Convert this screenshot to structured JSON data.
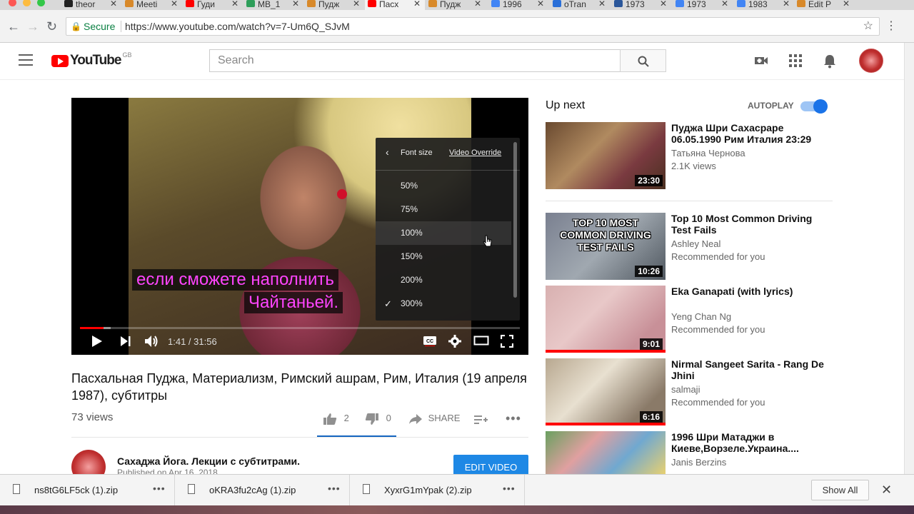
{
  "browser": {
    "tabs": [
      {
        "label": "theor",
        "color": "#222222"
      },
      {
        "label": "Meeti",
        "color": "#d8892a"
      },
      {
        "label": "Гуди",
        "color": "#ff0000"
      },
      {
        "label": "MB_1",
        "color": "#2e9e5a"
      },
      {
        "label": "Пудж",
        "color": "#d8892a"
      },
      {
        "label": "Пасх",
        "color": "#ff0000"
      },
      {
        "label": "Пудж",
        "color": "#d8892a"
      },
      {
        "label": "1996",
        "color": "#4285f4"
      },
      {
        "label": "oTran",
        "color": "#2a6fd8"
      },
      {
        "label": "1973",
        "color": "#2b579a"
      },
      {
        "label": "1973",
        "color": "#4285f4"
      },
      {
        "label": "1983",
        "color": "#4285f4"
      },
      {
        "label": "Edit P",
        "color": "#d8892a"
      }
    ],
    "active_tab": 5,
    "secure_label": "Secure",
    "url": "https://www.youtube.com/watch?v=7-Um6Q_SJvM"
  },
  "masthead": {
    "logo_text": "YouTube",
    "country": "GB",
    "search_placeholder": "Search"
  },
  "player": {
    "subtitle_line1": "если сможете наполнить",
    "subtitle_line2": "Чайтаньей.",
    "time": "1:41 / 31:56",
    "progress_played": 0.053,
    "progress_loaded": 0.07,
    "settings": {
      "header": "Font size",
      "override": "Video Override",
      "options": [
        "50%",
        "75%",
        "100%",
        "150%",
        "200%",
        "300%"
      ],
      "selected": "300%",
      "hovered": "100%"
    }
  },
  "video": {
    "title": "Пасхальная Пуджа, Материализм, Римский ашрам, Рим, Италия (19 апреля 1987), субтитры",
    "views": "73 views",
    "likes": "2",
    "dislikes": "0",
    "share": "SHARE",
    "channel": "Сахаджа Йога. Лекции с субтитрами.",
    "published": "Published on Apr 16, 2018",
    "edit_button": "EDIT VIDEO"
  },
  "sidebar": {
    "up_next": "Up next",
    "autoplay": "AUTOPLAY",
    "autoplay_on": true,
    "items": [
      {
        "title": "Пуджа Шри Сахасраре 06.05.1990 Рим Италия 23:29",
        "channel": "Татьяна Чернова",
        "meta": "2.1K views",
        "duration": "23:30"
      },
      {
        "title": "Top 10 Most Common Driving Test Fails",
        "channel": "Ashley Neal",
        "meta": "Recommended for you",
        "duration": "10:26",
        "thumb_text": "TOP 10 MOST COMMON DRIVING TEST FAILS"
      },
      {
        "title": "Eka Ganapati (with lyrics)",
        "channel": "Yeng Chan Ng",
        "meta": "Recommended for you",
        "duration": "9:01"
      },
      {
        "title": "Nirmal Sangeet Sarita - Rang De Jhini",
        "channel": "salmaji",
        "meta": "Recommended for you",
        "duration": "6:16"
      },
      {
        "title": "1996 Шри Матаджи в Киеве,Ворзеле.Украина....",
        "channel": "Janis Berzins",
        "meta": "",
        "duration": ""
      }
    ]
  },
  "downloads": {
    "files": [
      "ns8tG6LF5ck (1).zip",
      "oKRA3fu2cAg (1).zip",
      "XyxrG1mYpak (2).zip"
    ],
    "show_all": "Show All"
  }
}
